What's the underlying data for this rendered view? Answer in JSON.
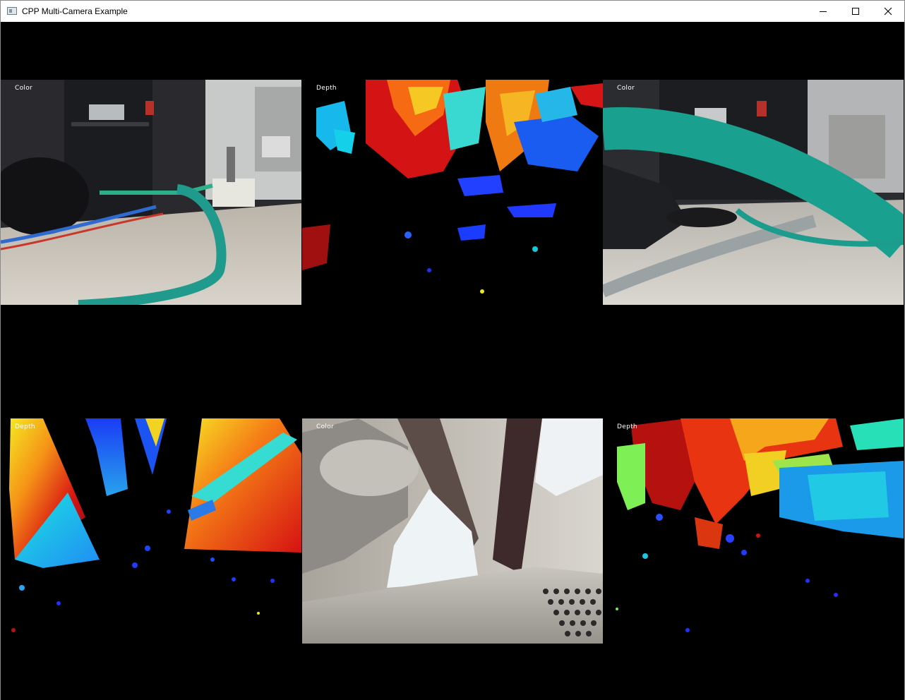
{
  "window": {
    "title": "CPP Multi-Camera Example",
    "controls": [
      "minimize-icon",
      "maximize-icon",
      "close-icon"
    ]
  },
  "views": [
    {
      "label": "Color",
      "stream": "color"
    },
    {
      "label": "Depth",
      "stream": "depth"
    },
    {
      "label": "Color",
      "stream": "color"
    },
    {
      "label": "Depth",
      "stream": "depth"
    },
    {
      "label": "Color",
      "stream": "color"
    },
    {
      "label": "Depth",
      "stream": "depth"
    }
  ],
  "colors": {
    "background": "#000000",
    "titlebar": "#ffffff",
    "cable_teal": "#1f9a8c",
    "depth_near": "#d0121a",
    "depth_far": "#1030ff"
  }
}
